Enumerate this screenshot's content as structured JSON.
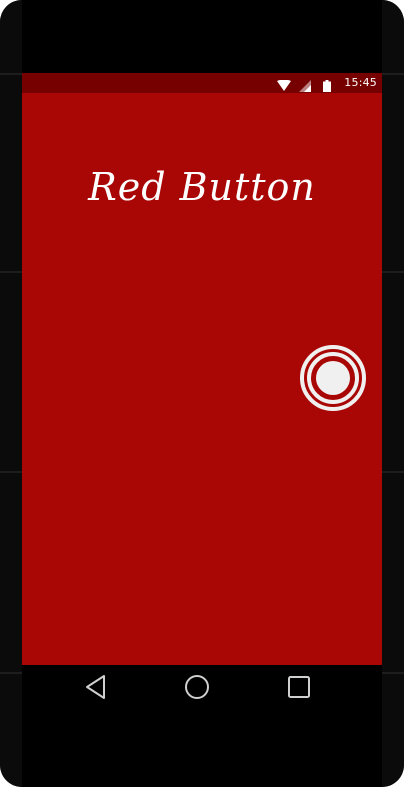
{
  "status_bar": {
    "time": "15:45",
    "icons": [
      "wifi-icon",
      "cell-signal-icon",
      "battery-icon"
    ]
  },
  "app": {
    "title": "Red Button"
  },
  "main_button": {
    "icon": "record-button-icon"
  },
  "nav_bar": {
    "buttons": [
      "back-icon",
      "home-icon",
      "recents-icon"
    ]
  },
  "colors": {
    "background": "#a80706",
    "status_bar": "#760000",
    "foreground": "#f0f0f0"
  }
}
